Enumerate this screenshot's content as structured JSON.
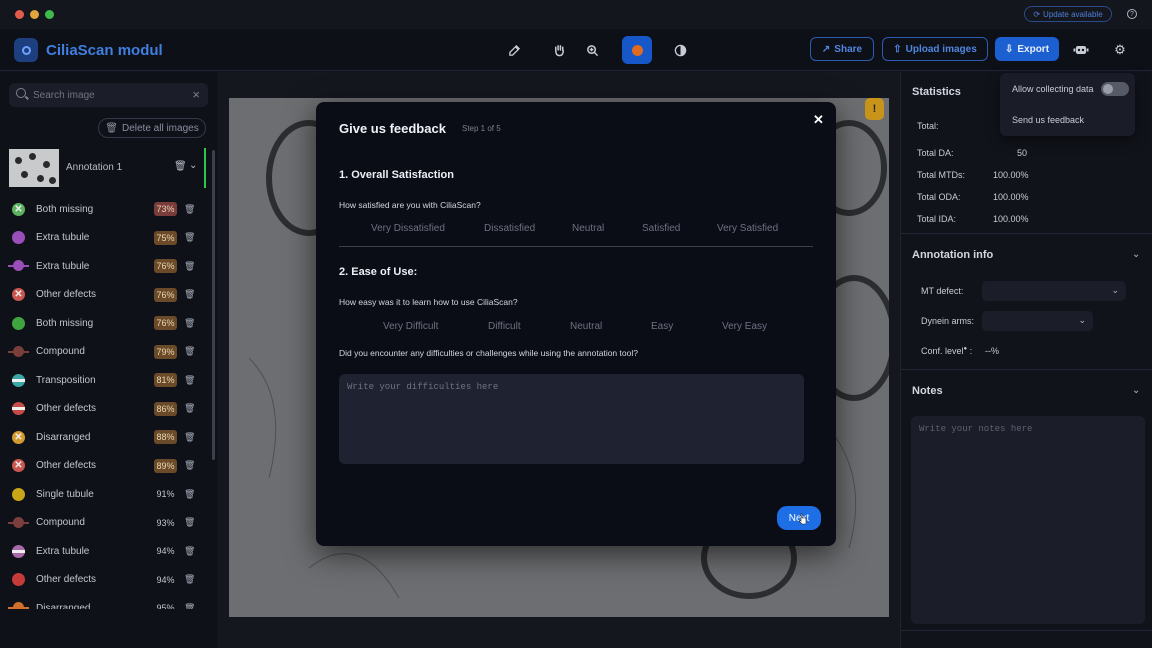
{
  "titlebar": {
    "traffic_lights": [
      "#e25c4e",
      "#e0a53b",
      "#3fbb4c"
    ],
    "update_label": "Update available"
  },
  "header": {
    "app_title": "CiliaScan modul",
    "share_label": "Share",
    "upload_label": "Upload images",
    "export_label": "Export",
    "active_color": "#e06a1f",
    "accent": "#1b5fd0"
  },
  "sidebar": {
    "search_placeholder": "Search image",
    "delete_all_label": "Delete all images",
    "annotation_name": "Annotation 1",
    "items": [
      {
        "label": "Both missing",
        "pct": "73%",
        "icon": "cross",
        "color": "#5bb35f",
        "badge": "#7a3b3b"
      },
      {
        "label": "Extra tubule",
        "pct": "75%",
        "icon": "dot",
        "color": "#9a4fb8",
        "badge": "#6b4a2a"
      },
      {
        "label": "Extra tubule",
        "pct": "76%",
        "icon": "line",
        "color": "#9a4fb8",
        "badge": "#6b4a2a"
      },
      {
        "label": "Other defects",
        "pct": "76%",
        "icon": "cross",
        "color": "#c9574f",
        "badge": "#6b4a2a"
      },
      {
        "label": "Both missing",
        "pct": "76%",
        "icon": "dot",
        "color": "#3fa63f",
        "badge": "#6b4a2a"
      },
      {
        "label": "Compound",
        "pct": "79%",
        "icon": "line",
        "color": "#7a3f3a",
        "badge": "#6b4a2a"
      },
      {
        "label": "Transposition",
        "pct": "81%",
        "icon": "bar",
        "color": "#3aa6a6",
        "badge": "#6b4a2a"
      },
      {
        "label": "Other defects",
        "pct": "86%",
        "icon": "bar",
        "color": "#c64a4a",
        "badge": "#6b4a2a"
      },
      {
        "label": "Disarranged",
        "pct": "88%",
        "icon": "cross",
        "color": "#d49a2f",
        "badge": "#6b4a2a"
      },
      {
        "label": "Other defects",
        "pct": "89%",
        "icon": "cross",
        "color": "#c9574f",
        "badge": "#6b4a2a"
      },
      {
        "label": "Single tubule",
        "pct": "91%",
        "icon": "dot",
        "color": "#c9a617",
        "badge": ""
      },
      {
        "label": "Compound",
        "pct": "93%",
        "icon": "line",
        "color": "#7a3f3a",
        "badge": ""
      },
      {
        "label": "Extra tubule",
        "pct": "94%",
        "icon": "bar",
        "color": "#a66aa8",
        "badge": ""
      },
      {
        "label": "Other defects",
        "pct": "94%",
        "icon": "dot",
        "color": "#c63a3a",
        "badge": ""
      },
      {
        "label": "Disarranged",
        "pct": "95%",
        "icon": "line",
        "color": "#d0702a",
        "badge": ""
      }
    ]
  },
  "right": {
    "statistics_title": "Statistics",
    "stats": [
      {
        "label": "Total:",
        "value": ""
      },
      {
        "label": "Total DA:",
        "value": "50"
      },
      {
        "label": "Total MTDs:",
        "value": "100.00%"
      },
      {
        "label": "Total ODA:",
        "value": "100.00%"
      },
      {
        "label": "Total IDA:",
        "value": "100.00%"
      }
    ],
    "annotation_info_title": "Annotation info",
    "mt_defect_label": "MT defect:",
    "dynein_label": "Dynein arms:",
    "conf_label": "Conf. level",
    "conf_value": "--%",
    "notes_title": "Notes",
    "notes_placeholder": "Write your notes here"
  },
  "dropdown": {
    "allow_label": "Allow collecting data",
    "feedback_label": "Send us feedback"
  },
  "modal": {
    "title": "Give us feedback",
    "step": "Step 1 of 5",
    "q1_title": "1. Overall Satisfaction",
    "q1_text": "How satisfied are you with CiliaScan?",
    "q1_options": [
      "Very Dissatisfied",
      "Dissatisfied",
      "Neutral",
      "Satisfied",
      "Very Satisfied"
    ],
    "q2_title": "2. Ease of Use:",
    "q2_text": "How easy was it to learn how to use CiliaScan?",
    "q2_options": [
      "Very Difficult",
      "Difficult",
      "Neutral",
      "Easy",
      "Very Easy"
    ],
    "q3_text": "Did you encounter any difficulties or challenges while using the annotation tool?",
    "q3_placeholder": "Write your difficulties here",
    "next_label": "Next"
  }
}
